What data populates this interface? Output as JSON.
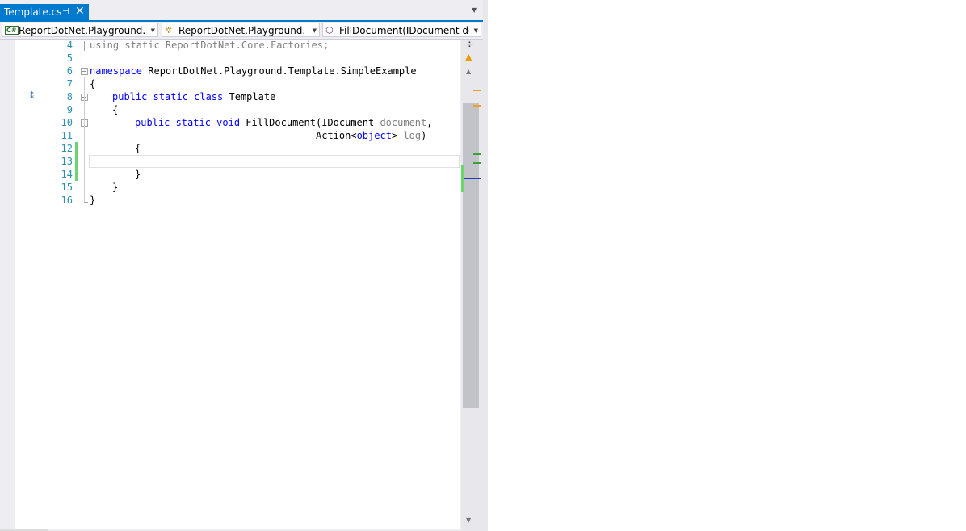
{
  "tab": {
    "title": "Template.cs",
    "pin_glyph": "⊣",
    "close_glyph": "✕"
  },
  "navbar": {
    "project_dropdown": "ReportDotNet.Playground.Tem",
    "class_dropdown": "ReportDotNet.Playground.Tem",
    "member_dropdown": "FillDocument(IDocument docu",
    "cs_badge": "C#"
  },
  "editor": {
    "line_numbers": [
      "4",
      "5",
      "6",
      "7",
      "8",
      "9",
      "10",
      "11",
      "12",
      "13",
      "14",
      "15",
      "16"
    ],
    "lines": {
      "l4": "using static ReportDotNet.Core.Factories;",
      "l6_kw": "namespace",
      "l6_name": " ReportDotNet.Playground.Template.SimpleExample",
      "l7": "{",
      "l8_kw": "public static class",
      "l8_name": " Template",
      "l9": "{",
      "l10_kw": "public static void",
      "l10_method": " FillDocument(",
      "l10_type": "IDocument",
      "l10_param": " document",
      "l10_comma": ",",
      "l11_type": "Action<",
      "l11_kw": "object",
      "l11_close": "> ",
      "l11_param": "log",
      "l11_end": ")",
      "l12": "{",
      "l14": "}",
      "l15": "}",
      "l16": "}"
    }
  },
  "colors": {
    "accent": "#007acc",
    "keyword": "#0000ff",
    "type": "#2b91af",
    "changed": "#6cd66c"
  }
}
